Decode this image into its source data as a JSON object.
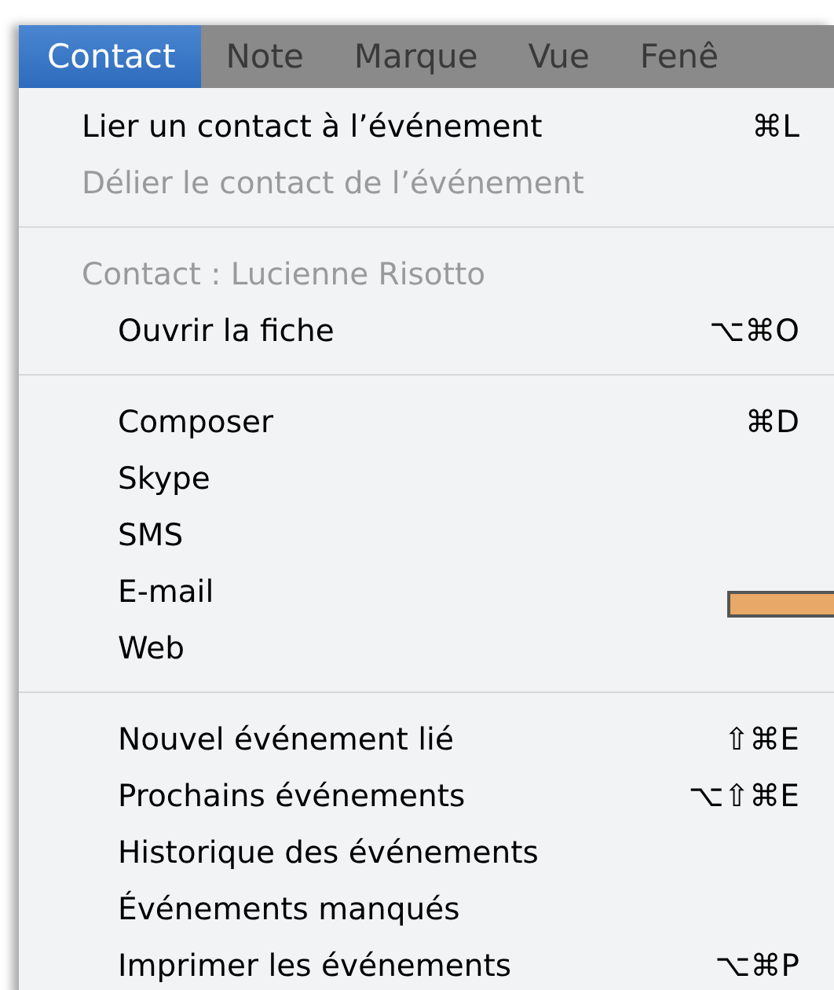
{
  "menubar": {
    "items": [
      {
        "label": "Contact",
        "selected": true
      },
      {
        "label": "Note",
        "selected": false
      },
      {
        "label": "Marque",
        "selected": false
      },
      {
        "label": "Vue",
        "selected": false
      },
      {
        "label": "Fenê",
        "selected": false
      }
    ]
  },
  "menu": {
    "entries": [
      {
        "kind": "item",
        "label": "Lier un contact à l’événement",
        "shortcut": "⌘L",
        "disabled": false
      },
      {
        "kind": "item",
        "label": "Délier le contact de l’événement",
        "disabled": true
      },
      {
        "kind": "separator"
      },
      {
        "kind": "group",
        "label": "Contact : Lucienne Risotto",
        "disabled": true,
        "children": [
          {
            "kind": "item",
            "label": "Ouvrir la fiche",
            "shortcut": "⌥⌘O",
            "disabled": false
          },
          {
            "kind": "separator"
          },
          {
            "kind": "item",
            "label": "Composer",
            "shortcut": "⌘D",
            "disabled": false
          },
          {
            "kind": "item",
            "label": "Skype",
            "disabled": false
          },
          {
            "kind": "item",
            "label": "SMS",
            "disabled": false
          },
          {
            "kind": "item",
            "label": "E-mail",
            "disabled": false
          },
          {
            "kind": "item",
            "label": "Web",
            "disabled": false
          },
          {
            "kind": "separator"
          },
          {
            "kind": "item",
            "label": "Nouvel événement lié",
            "shortcut": "⇧⌘E",
            "disabled": false
          },
          {
            "kind": "item",
            "label": "Prochains événements",
            "shortcut": "⌥⇧⌘E",
            "disabled": false
          },
          {
            "kind": "item",
            "label": "Historique des événements",
            "disabled": false
          },
          {
            "kind": "item",
            "label": "Événements manqués",
            "disabled": false
          },
          {
            "kind": "item",
            "label": "Imprimer les événements",
            "shortcut": "⌥⌘P",
            "disabled": false
          }
        ]
      }
    ]
  }
}
